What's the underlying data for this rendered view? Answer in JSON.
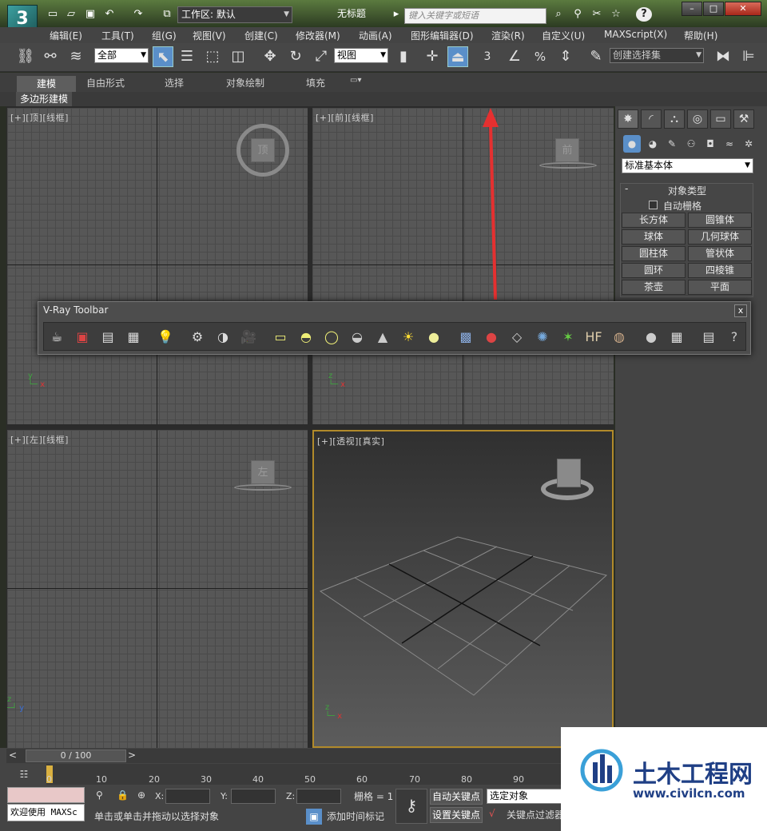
{
  "titlebar": {
    "workspace_label": "工作区: 默认",
    "doc_title": "无标题",
    "search_placeholder": "键入关键字或短语",
    "help_symbol": "?"
  },
  "menu": [
    "编辑(E)",
    "工具(T)",
    "组(G)",
    "视图(V)",
    "创建(C)",
    "修改器(M)",
    "动画(A)",
    "图形编辑器(D)",
    "渲染(R)",
    "自定义(U)",
    "MAXScript(X)",
    "帮助(H)"
  ],
  "toolbar": {
    "filter_value": "全部",
    "refcoord_value": "视图",
    "named_selection_value": "创建选择集",
    "snap_label": "3",
    "angle_snap_label": "∠",
    "percent_snap_label": "%"
  },
  "ribbon": {
    "tabs": [
      "建模",
      "自由形式",
      "选择",
      "对象绘制",
      "填充"
    ],
    "panel_label": "多边形建模"
  },
  "viewports": {
    "top_label": "[+][顶][线框]",
    "front_label": "[+][前][线框]",
    "left_label": "[+][左][线框]",
    "persp_label": "[+][透视][真实]",
    "top_cube": "顶",
    "front_cube": "前",
    "left_cube": "左"
  },
  "command_panel": {
    "category_value": "标准基本体",
    "rollout_title": "对象类型",
    "rollout_toggle": "-",
    "autogrid_label": "自动栅格",
    "object_types": [
      "长方体",
      "圆锥体",
      "球体",
      "几何球体",
      "圆柱体",
      "管状体",
      "圆环",
      "四棱锥",
      "茶壶",
      "平面"
    ]
  },
  "vray_toolbar": {
    "title": "V-Ray Toolbar",
    "close_label": "x"
  },
  "timeline": {
    "frame_label": "0 / 100",
    "ticks": [
      "0",
      "10",
      "20",
      "30",
      "40",
      "50",
      "60",
      "70",
      "80",
      "90"
    ]
  },
  "statusbar": {
    "welcome": "欢迎使用 MAXSc",
    "prompt": "单击或单击并拖动以选择对象",
    "x_label": "X:",
    "y_label": "Y:",
    "z_label": "Z:",
    "grid_label": "栅格 = 1",
    "add_time_tag": "添加时间标记",
    "auto_key": "自动关键点",
    "set_key": "设置关键点",
    "selected_object": "选定对象",
    "key_filter": "关键点过滤器"
  },
  "watermark": {
    "site_name": "土木工程网",
    "url": "www.civilcn.com"
  },
  "colors": {
    "accent": "#b18a2a",
    "arrow": "#e53030",
    "watermark_blue": "#1f3f85"
  }
}
